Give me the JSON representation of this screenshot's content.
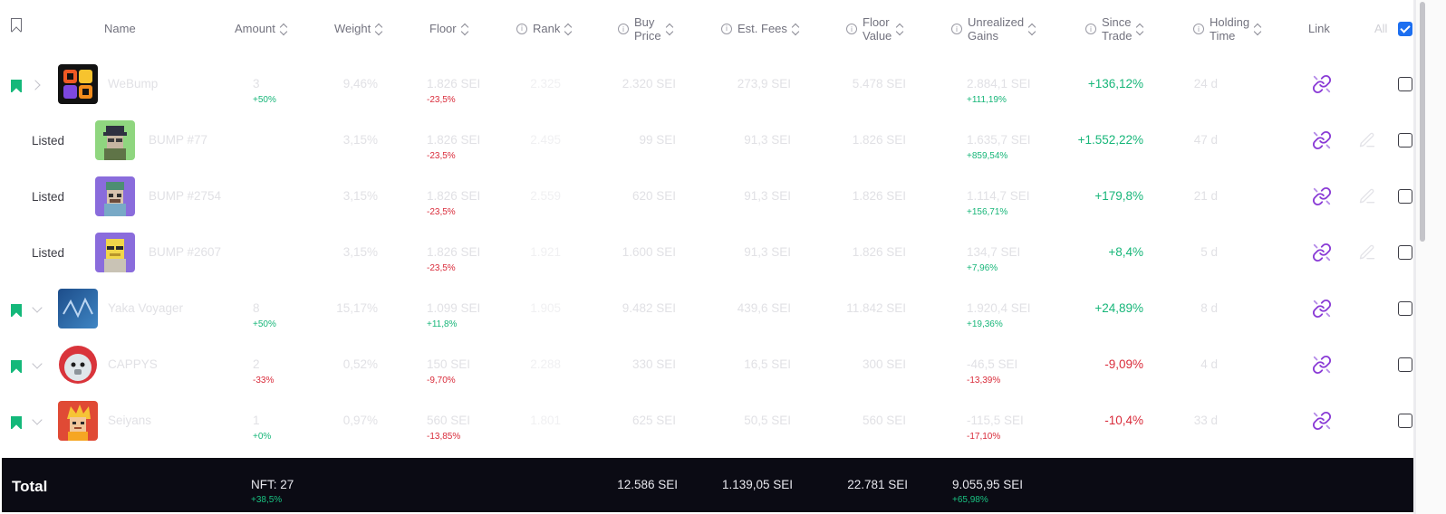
{
  "header": {
    "name": "Name",
    "amount": "Amount",
    "weight": "Weight",
    "floor": "Floor",
    "rank": "Rank",
    "buy_price": [
      "Buy",
      "Price"
    ],
    "est_fees": "Est. Fees",
    "floor_value": [
      "Floor",
      "Value"
    ],
    "unrealized_gains": [
      "Unrealized",
      "Gains"
    ],
    "since_trade": [
      "Since",
      "Trade"
    ],
    "holding_time": [
      "Holding",
      "Time"
    ],
    "link": "Link",
    "all": "All"
  },
  "rows": [
    {
      "listed": "",
      "name": "WeBump",
      "amount": "3",
      "amount_change": "+50%",
      "weight": "9,46%",
      "floor": "1.826 SEI",
      "floor_change": "-23,5%",
      "rank": "2.325",
      "buy_price": "2.320 SEI",
      "est_fees": "273,9 SEI",
      "floor_value": "5.478 SEI",
      "gains": "2.884,1 SEI",
      "gains_pct": "+111,19%",
      "since_trade": "+136,12%",
      "holding_time": "24 d"
    },
    {
      "listed": "Listed",
      "name": "BUMP #77",
      "amount": "",
      "amount_change": "",
      "weight": "3,15%",
      "floor": "1.826 SEI",
      "floor_change": "-23,5%",
      "rank": "2.495",
      "buy_price": "99 SEI",
      "est_fees": "91,3 SEI",
      "floor_value": "1.826 SEI",
      "gains": "1.635,7 SEI",
      "gains_pct": "+859,54%",
      "since_trade": "+1.552,22%",
      "holding_time": "47 d"
    },
    {
      "listed": "Listed",
      "name": "BUMP #2754",
      "amount": "",
      "amount_change": "",
      "weight": "3,15%",
      "floor": "1.826 SEI",
      "floor_change": "-23,5%",
      "rank": "2.559",
      "buy_price": "620 SEI",
      "est_fees": "91,3 SEI",
      "floor_value": "1.826 SEI",
      "gains": "1.114,7 SEI",
      "gains_pct": "+156,71%",
      "since_trade": "+179,8%",
      "holding_time": "21 d"
    },
    {
      "listed": "Listed",
      "name": "BUMP #2607",
      "amount": "",
      "amount_change": "",
      "weight": "3,15%",
      "floor": "1.826 SEI",
      "floor_change": "-23,5%",
      "rank": "1.921",
      "buy_price": "1.600 SEI",
      "est_fees": "91,3 SEI",
      "floor_value": "1.826 SEI",
      "gains": "134,7 SEI",
      "gains_pct": "+7,96%",
      "since_trade": "+8,4%",
      "holding_time": "5 d"
    },
    {
      "listed": "",
      "name": "Yaka Voyager",
      "amount": "8",
      "amount_change": "+50%",
      "weight": "15,17%",
      "floor": "1.099 SEI",
      "floor_change": "+11,8%",
      "rank": "1.905",
      "buy_price": "9.482 SEI",
      "est_fees": "439,6 SEI",
      "floor_value": "11.842 SEI",
      "gains": "1.920,4 SEI",
      "gains_pct": "+19,36%",
      "since_trade": "+24,89%",
      "holding_time": "8 d"
    },
    {
      "listed": "",
      "name": "CAPPYS",
      "amount": "2",
      "amount_change": "-33%",
      "weight": "0,52%",
      "floor": "150 SEI",
      "floor_change": "-9,70%",
      "rank": "2.288",
      "buy_price": "330 SEI",
      "est_fees": "16,5 SEI",
      "floor_value": "300 SEI",
      "gains": "-46,5 SEI",
      "gains_pct": "-13,39%",
      "since_trade": "-9,09%",
      "holding_time": "4 d"
    },
    {
      "listed": "",
      "name": "Seiyans",
      "amount": "1",
      "amount_change": "+0%",
      "weight": "0,97%",
      "floor": "560 SEI",
      "floor_change": "-13,85%",
      "rank": "1.801",
      "buy_price": "625 SEI",
      "est_fees": "50,5 SEI",
      "floor_value": "560 SEI",
      "gains": "-115,5 SEI",
      "gains_pct": "-17,10%",
      "since_trade": "-10,4%",
      "holding_time": "33 d"
    }
  ],
  "total": {
    "label": "Total",
    "nft": "NFT: 27",
    "nft_change": "+38,5%",
    "buy_price": "12.586 SEI",
    "est_fees": "1.139,05 SEI",
    "floor_value": "22.781 SEI",
    "gains": "9.055,95 SEI",
    "gains_pct": "+65,98%"
  },
  "colors": {
    "positive": "#17b679",
    "negative": "#d92b3a",
    "accent": "#1d6ff0",
    "link_icon": "#8a3bd6",
    "bookmark": "#14b87a",
    "total_bar": "#0b0b14"
  },
  "icons": {
    "bookmark": "bookmark-icon",
    "expand": "chevron-icon",
    "link": "link-icon",
    "edit": "edit-icon",
    "info": "info-icon",
    "sort": "sort-icon"
  }
}
